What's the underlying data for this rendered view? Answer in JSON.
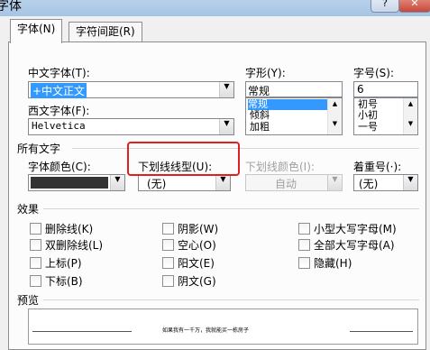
{
  "window": {
    "title": "字体",
    "help_label": "?",
    "close_label": "✕"
  },
  "tabs": [
    {
      "label": "字体(N)"
    },
    {
      "label": "字符间距(R)"
    }
  ],
  "font": {
    "chinese_font_label": "中文字体(T):",
    "chinese_font_value": "+中文正文",
    "western_font_label": "西文字体(F):",
    "western_font_value": "Helvetica",
    "style_label": "字形(Y):",
    "style_value": "常规",
    "style_options": [
      "常规",
      "倾斜",
      "加粗"
    ],
    "size_label": "字号(S):",
    "size_value": "6",
    "size_options": [
      "初号",
      "小初",
      "一号"
    ]
  },
  "all_text": {
    "section_label": "所有文字",
    "font_color_label": "字体颜色(C):",
    "font_color_value": "#333333",
    "underline_type_label": "下划线线型(U):",
    "underline_type_value": "(无)",
    "underline_color_label": "下划线颜色(I):",
    "underline_color_value": "自动",
    "emphasis_label": "着重号(·):",
    "emphasis_value": "(无)"
  },
  "effects": {
    "section_label": "效果",
    "items": [
      "删除线(K)",
      "双删除线(L)",
      "上标(P)",
      "下标(B)",
      "阴影(W)",
      "空心(O)",
      "阳文(E)",
      "阴文(G)",
      "小型大写字母(M)",
      "全部大写字母(A)",
      "隐藏(H)"
    ]
  },
  "preview": {
    "section_label": "预览",
    "sample_text": "如果我有一千万，我就能买一栋房子"
  },
  "highlight_color": "#e02020"
}
